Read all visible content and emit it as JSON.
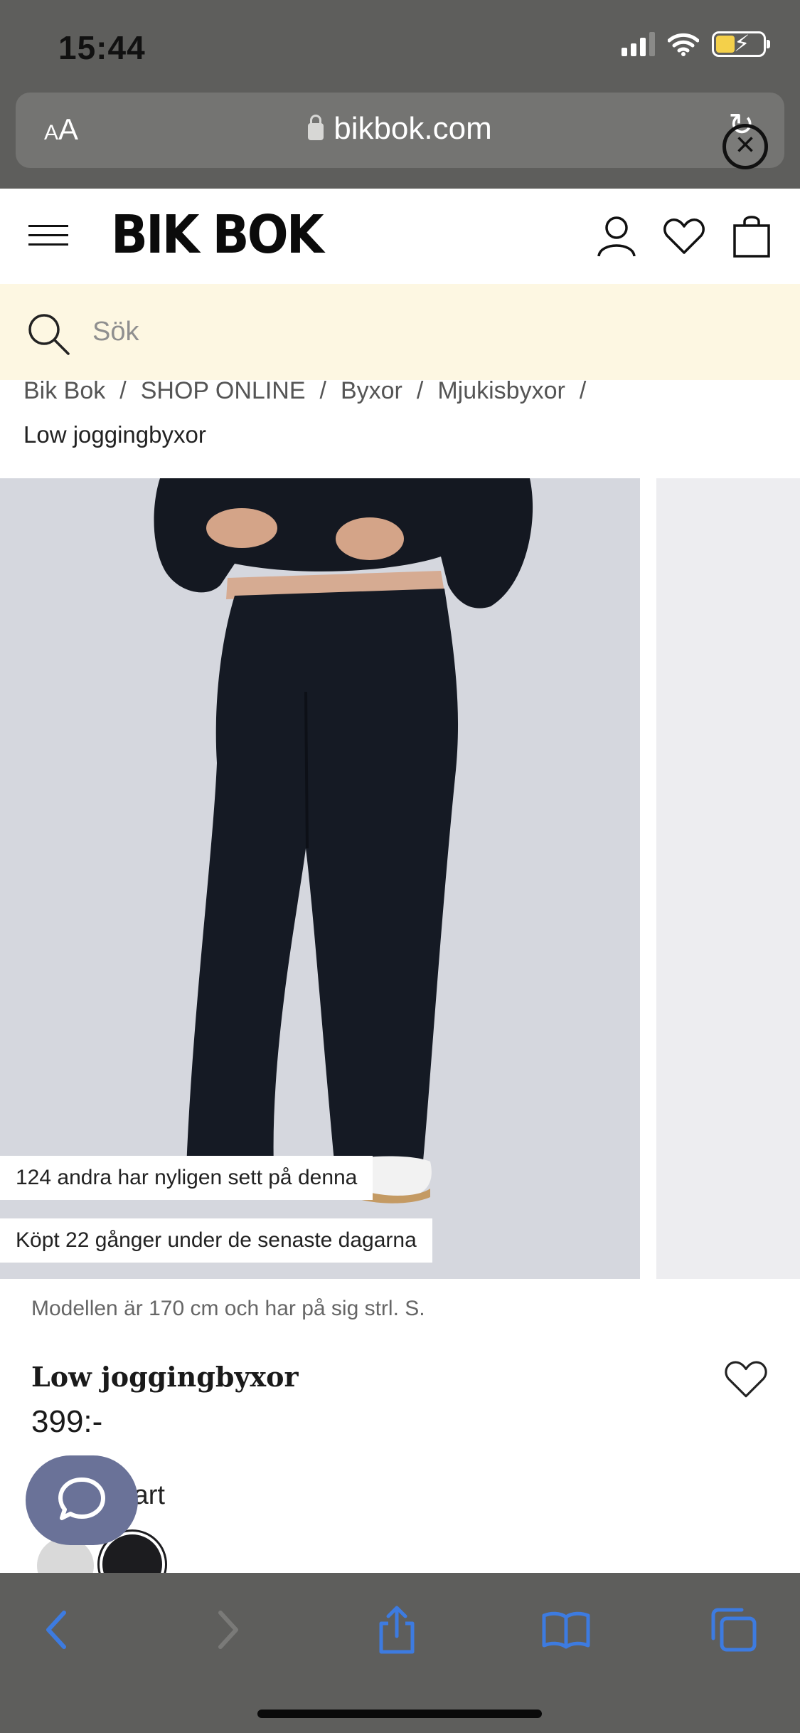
{
  "status_bar": {
    "time": "15:44"
  },
  "browser": {
    "text_size_label": "AA",
    "url": "bikbok.com"
  },
  "header": {
    "logo": "BIK BOK"
  },
  "search": {
    "placeholder": "Sök"
  },
  "breadcrumb": {
    "items": [
      "Bik Bok",
      "SHOP ONLINE",
      "Byxor",
      "Mjukisbyxor"
    ],
    "separator": "/",
    "current": "Low joggingbyxor"
  },
  "product": {
    "badges": [
      "124 andra har nyligen sett på denna",
      "Köpt 22 gånger under de senaste dagarna"
    ],
    "model_note": "Modellen är 170 cm och har på sig strl. S.",
    "title": "Low joggingbyxor",
    "price": "399:-",
    "color_label": "Färg: Svart",
    "swatch_colors": [
      "#d9d9d9",
      "#1c1c1f"
    ]
  },
  "colors": {
    "chrome_bg": "#5e5e5c",
    "search_band": "#fdf7e2",
    "accent_blue": "#3d7be0",
    "chat_bubble": "#6a7298"
  }
}
